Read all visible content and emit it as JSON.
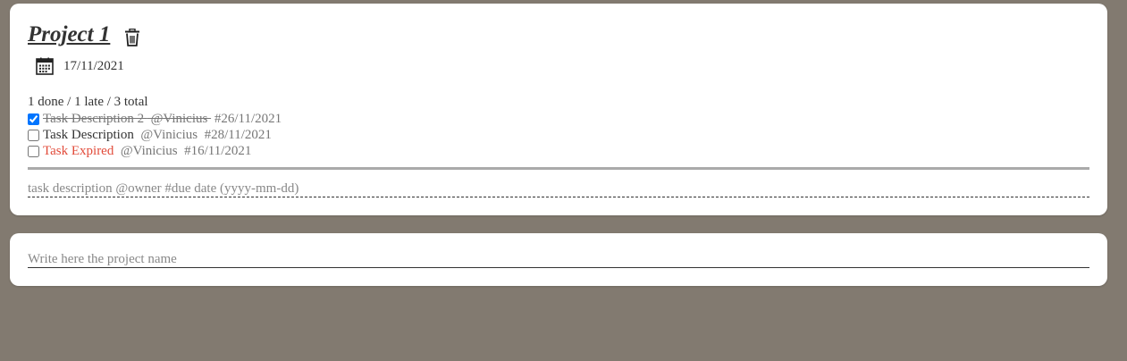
{
  "project": {
    "title": "Project 1",
    "date": "17/11/2021",
    "summary": "1 done / 1 late / 3 total",
    "tasks": [
      {
        "description": "Task Description 2 ",
        "owner": " @Vinicius ",
        "due": " #26/11/2021",
        "done": true,
        "expired": false
      },
      {
        "description": "Task Description ",
        "owner": " @Vinicius ",
        "due": " #28/11/2021",
        "done": false,
        "expired": false
      },
      {
        "description": "Task Expired ",
        "owner": " @Vinicius ",
        "due": " #16/11/2021",
        "done": false,
        "expired": true
      }
    ],
    "task_input_placeholder": "task description @owner #due date (yyyy-mm-dd)",
    "icons": {
      "delete": "trash-icon",
      "date": "calendar-icon"
    }
  },
  "new_project": {
    "placeholder": "Write here the project name"
  },
  "colors": {
    "background": "#827a70",
    "card": "#ffffff",
    "expired": "#e24b3a",
    "muted": "#777777"
  }
}
